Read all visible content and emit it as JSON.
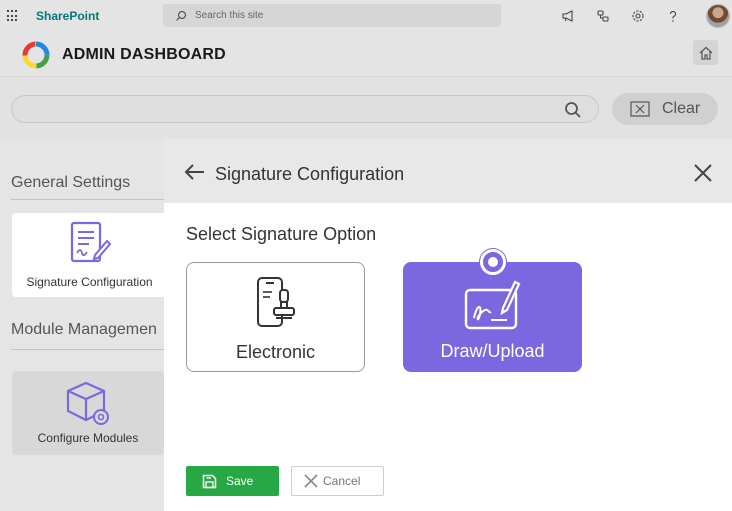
{
  "suite": {
    "brand": "SharePoint",
    "search_placeholder": "Search this site",
    "icons": [
      "megaphone-icon",
      "share-icon",
      "settings-icon",
      "help-icon"
    ]
  },
  "app": {
    "title": "ADMIN DASHBOARD",
    "home_icon": "home-icon"
  },
  "search": {
    "placeholder": "",
    "clear_label": "Clear"
  },
  "background": {
    "general_settings_title": "General Settings",
    "signature_tile_label": "Signature Configuration",
    "module_title": "Module Managemen",
    "configure_modules_label": "Configure Modules"
  },
  "panel": {
    "title": "Signature Configuration",
    "option_heading": "Select Signature Option",
    "options": [
      {
        "label": "Electronic",
        "icon": "phone-stamp-icon",
        "selected": false
      },
      {
        "label": "Draw/Upload",
        "icon": "draw-signature-icon",
        "selected": true
      }
    ],
    "save_label": "Save",
    "cancel_label": "Cancel"
  },
  "colors": {
    "accent": "#7b68e0",
    "save": "#28a745",
    "brand_teal": "#03787c"
  }
}
